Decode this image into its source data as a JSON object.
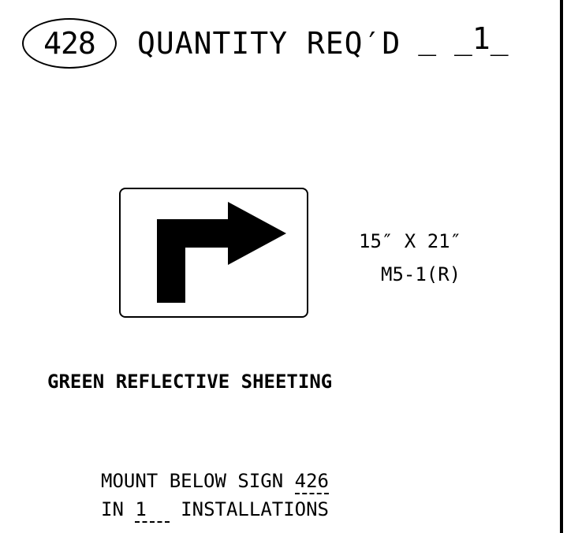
{
  "header": {
    "item_number": "428",
    "quantity_label": "QUANTITY REQ′D",
    "quantity_value": "_ _1_"
  },
  "sign": {
    "size": "15″ X 21″",
    "code": "M5-1(R)",
    "symbol": "right-turn-arrow-icon"
  },
  "sheeting": "GREEN REFLECTIVE SHEETING",
  "mount": {
    "prefix": "MOUNT BELOW SIGN ",
    "sign_ref": "426",
    "installs_prefix": "IN ",
    "installs_count": "1",
    "installs_suffix": " INSTALLATIONS"
  },
  "colors": {
    "ink": "#000000",
    "paper": "#ffffff"
  }
}
